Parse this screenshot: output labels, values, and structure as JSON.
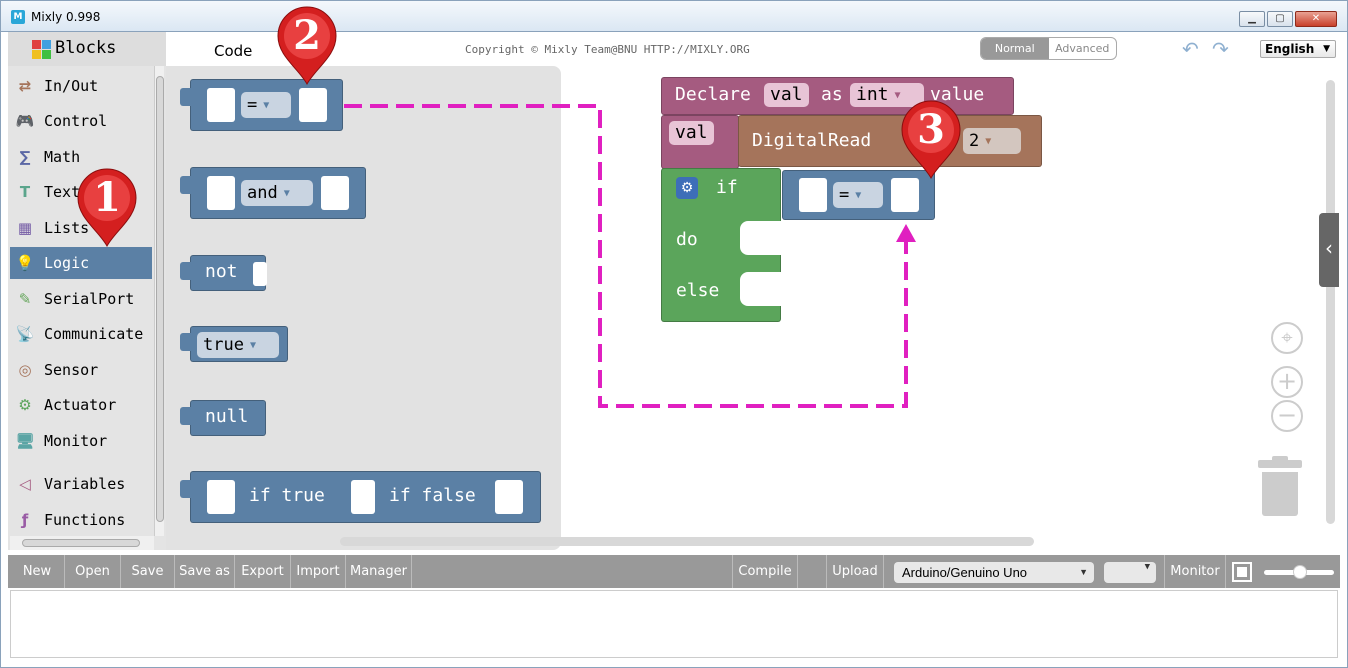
{
  "window": {
    "title": "Mixly 0.998",
    "logo": "M",
    "controls": [
      "▁",
      "▢",
      "✕"
    ]
  },
  "sidebar": {
    "title": "Blocks",
    "categories": [
      {
        "label": "In/Out",
        "icon": "arrows-icon",
        "color": "#a5745b",
        "glyph": "⇄"
      },
      {
        "label": "Control",
        "icon": "gamepad-icon",
        "color": "#5ba55b",
        "glyph": "🎮"
      },
      {
        "label": "Math",
        "icon": "math-icon",
        "color": "#5b67a5",
        "glyph": "∑"
      },
      {
        "label": "Text",
        "icon": "text-icon",
        "color": "#5ba58c",
        "glyph": "T"
      },
      {
        "label": "Lists",
        "icon": "lists-icon",
        "color": "#745ba5",
        "glyph": "▦"
      },
      {
        "label": "Logic",
        "icon": "bulb-icon",
        "color": "#5b80a5",
        "glyph": "💡",
        "selected": true
      },
      {
        "label": "SerialPort",
        "icon": "pen-icon",
        "color": "#65a55b",
        "glyph": "✎"
      },
      {
        "label": "Communicate",
        "icon": "satellite-icon",
        "color": "#5ba5a5",
        "glyph": "📡"
      },
      {
        "label": "Sensor",
        "icon": "sensor-icon",
        "color": "#a5745b",
        "glyph": "◎"
      },
      {
        "label": "Actuator",
        "icon": "actuator-icon",
        "color": "#5ba55b",
        "glyph": "⚙"
      },
      {
        "label": "Monitor",
        "icon": "monitor-icon",
        "color": "#5ba5a5",
        "glyph": "🖥"
      },
      {
        "label": "Variables",
        "icon": "variables-icon",
        "color": "#a55b80",
        "glyph": "◁"
      },
      {
        "label": "Functions",
        "icon": "functions-icon",
        "color": "#995ba5",
        "glyph": "ƒ"
      }
    ]
  },
  "header": {
    "code_tab": "Code",
    "copyright": "Copyright © Mixly Team@BNU HTTP://MIXLY.ORG",
    "modes": [
      "Normal",
      "Advanced"
    ],
    "language": "English"
  },
  "flyout": {
    "compare_op": "=",
    "and_op": "and",
    "not_label": "not",
    "bool_value": "true",
    "null_label": "null",
    "ternary_true": "if true",
    "ternary_false": "if false"
  },
  "program": {
    "declare_label": "Declare",
    "var_name": "val",
    "as_label": "as",
    "var_type": "int",
    "value_label": "value",
    "assign_var": "val",
    "digitalread_label": "DigitalRead",
    "pin_value": "2",
    "if_label": "if",
    "do_label": "do",
    "else_label": "else",
    "compare_op": "="
  },
  "markers": [
    "1",
    "2",
    "3"
  ],
  "toolbar": {
    "buttons": [
      "New",
      "Open",
      "Save",
      "Save as",
      "Export",
      "Import",
      "Manager",
      "Compile",
      "Upload"
    ],
    "board": "Arduino/Genuino Uno",
    "monitor": "Monitor"
  },
  "colors": {
    "logic": "#5b80a5",
    "variables": "#a55b80",
    "inout": "#a5745b",
    "control": "#5ba55b",
    "marker": "#e02020",
    "arrow": "#e020c0"
  }
}
